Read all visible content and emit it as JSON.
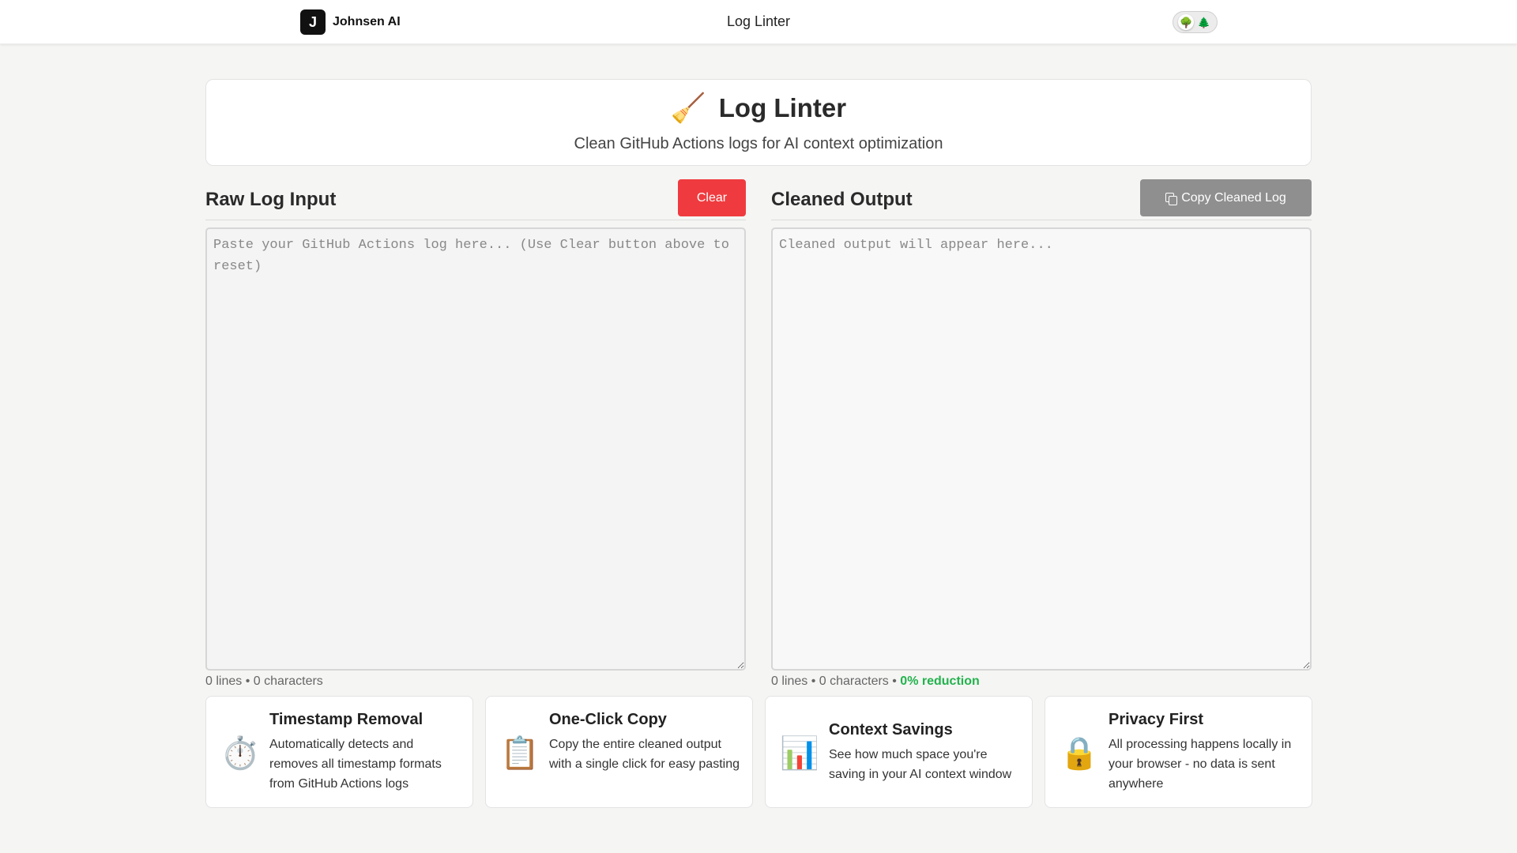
{
  "nav": {
    "logo_letter": "J",
    "brand": "Johnsen AI",
    "title": "Log Linter",
    "theme_icons": [
      "🌳",
      "🌲"
    ]
  },
  "hero": {
    "icon": "🧹",
    "title": "Log Linter",
    "subtitle": "Clean GitHub Actions logs for AI context optimization"
  },
  "input_panel": {
    "title": "Raw Log Input",
    "clear_label": "Clear",
    "placeholder": "Paste your GitHub Actions log here... (Use Clear button above to reset)",
    "value": "",
    "lines": "0 lines",
    "chars": "0 characters"
  },
  "output_panel": {
    "title": "Cleaned Output",
    "copy_label": "Copy Cleaned Log",
    "placeholder": "Cleaned output will appear here...",
    "value": "",
    "lines": "0 lines",
    "chars": "0 characters",
    "reduction": "0% reduction"
  },
  "features": [
    {
      "icon": "⏱️",
      "title": "Timestamp Removal",
      "desc": "Automatically detects and removes all timestamp formats from GitHub Actions logs"
    },
    {
      "icon": "📋",
      "title": "One-Click Copy",
      "desc": "Copy the entire cleaned output with a single click for easy pasting"
    },
    {
      "icon": "📊",
      "title": "Context Savings",
      "desc": "See how much space you're saving in your AI context window"
    },
    {
      "icon": "🔒",
      "title": "Privacy First",
      "desc": "All processing happens locally in your browser - no data is sent anywhere"
    }
  ],
  "colors": {
    "clear_button": "#ef3b3f",
    "copy_button": "#8f8f8f",
    "reduction_text": "#22b24c"
  }
}
